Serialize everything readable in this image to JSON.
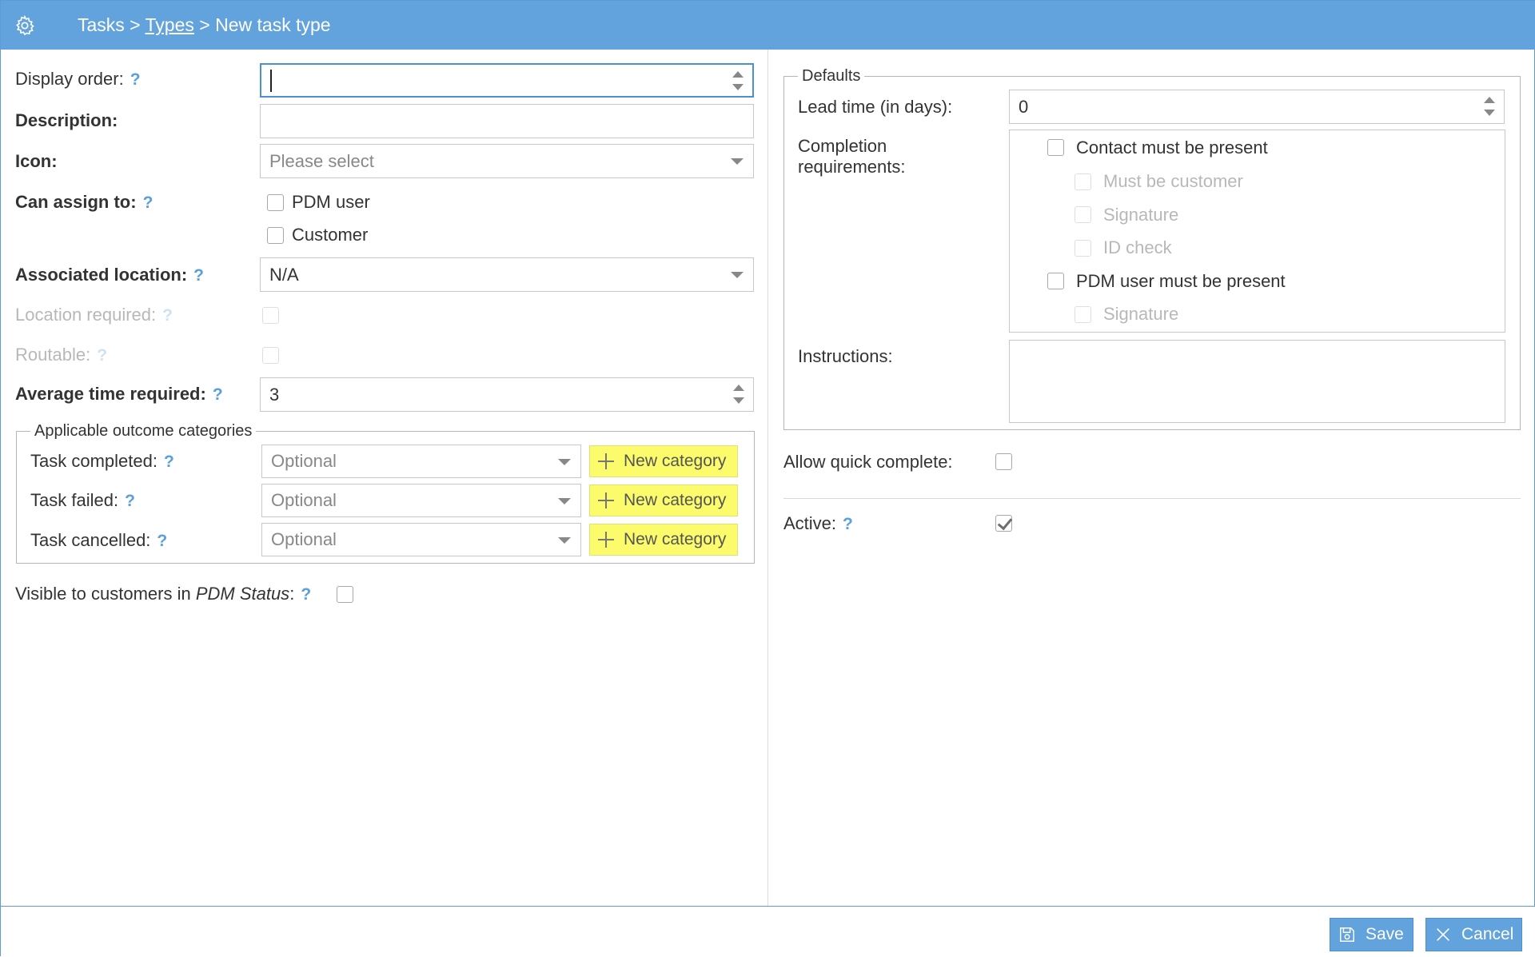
{
  "header": {
    "crumb_tasks": "Tasks",
    "sep1": " > ",
    "crumb_types": "Types",
    "sep2": " > ",
    "crumb_current": "New task type",
    "icon": "gear-icon",
    "bg_color": "#62a3de"
  },
  "left": {
    "display_order": {
      "label": "Display order:",
      "help": "?",
      "value": ""
    },
    "description": {
      "label": "Description:",
      "value": ""
    },
    "icon": {
      "label": "Icon:",
      "placeholder": "Please select"
    },
    "can_assign_to": {
      "label": "Can assign to:",
      "help": "?",
      "options": [
        {
          "label": "PDM user",
          "checked": false
        },
        {
          "label": "Customer",
          "checked": false
        }
      ]
    },
    "associated_location": {
      "label": "Associated location:",
      "help": "?",
      "value": "N/A"
    },
    "location_required": {
      "label": "Location required:",
      "help": "?",
      "checked": false
    },
    "routable": {
      "label": "Routable:",
      "help": "?",
      "checked": false
    },
    "average_time": {
      "label": "Average time required:",
      "help": "?",
      "value": "3"
    },
    "outcomes": {
      "legend": "Applicable outcome categories",
      "rows": [
        {
          "label": "Task completed:",
          "help": "?",
          "placeholder": "Optional",
          "button": "New category"
        },
        {
          "label": "Task failed:",
          "help": "?",
          "placeholder": "Optional",
          "button": "New category"
        },
        {
          "label": "Task cancelled:",
          "help": "?",
          "placeholder": "Optional",
          "button": "New category"
        }
      ],
      "button_color": "#fbfb6c"
    },
    "visible": {
      "label_prefix": "Visible to customers in ",
      "label_em": "PDM Status",
      "label_suffix": ":",
      "help": "?",
      "checked": false
    }
  },
  "right": {
    "defaults": {
      "legend": "Defaults",
      "lead_time": {
        "label": "Lead time (in days):",
        "value": "0"
      },
      "completion": {
        "label_line1": "Completion",
        "label_line2": "requirements:",
        "items": [
          {
            "label": "Contact must be present",
            "checked": false,
            "disabled": false
          },
          {
            "label": "Must be customer",
            "checked": false,
            "disabled": true
          },
          {
            "label": "Signature",
            "checked": false,
            "disabled": true
          },
          {
            "label": "ID check",
            "checked": false,
            "disabled": true
          },
          {
            "label": "PDM user must be present",
            "checked": false,
            "disabled": false
          },
          {
            "label": "Signature",
            "checked": false,
            "disabled": true
          }
        ]
      },
      "instructions": {
        "label": "Instructions:",
        "value": ""
      }
    },
    "allow_quick_complete": {
      "label": "Allow quick complete:",
      "checked": false
    },
    "active": {
      "label": "Active:",
      "help": "?",
      "checked": true
    }
  },
  "footer": {
    "save": {
      "label": "Save",
      "icon": "save-icon"
    },
    "cancel": {
      "label": "Cancel",
      "icon": "close-icon"
    }
  }
}
